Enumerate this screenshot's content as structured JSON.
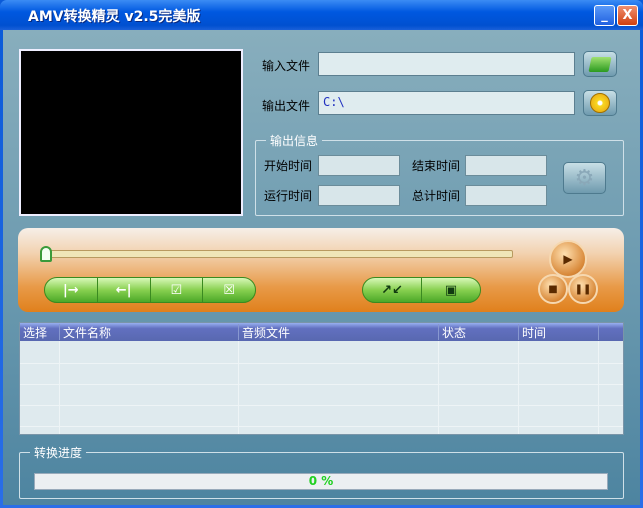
{
  "window": {
    "title": "AMV转换精灵 v2.5完美版",
    "minimize": "_",
    "close": "X"
  },
  "files": {
    "input_label": "输入文件",
    "input_value": "",
    "output_label": "输出文件",
    "output_value": "C:\\"
  },
  "output_info": {
    "legend": "输出信息",
    "start_label": "开始时间",
    "end_label": "结束时间",
    "run_label": "运行时间",
    "total_label": "总计时间",
    "start": "",
    "end": "",
    "run": "",
    "total": ""
  },
  "player": {
    "position": 0,
    "icons": [
      "set-start-icon",
      "set-end-icon",
      "check-all-icon",
      "uncheck-all-icon",
      "convert-icon",
      "stop-convert-icon",
      "play-icon",
      "stop-icon",
      "pause-icon"
    ]
  },
  "table": {
    "columns": [
      "选择",
      "文件名称",
      "音频文件",
      "状态",
      "时间"
    ],
    "rows": []
  },
  "progress": {
    "legend": "转换进度",
    "text": "0 %",
    "value": 0,
    "color": "#20d020"
  }
}
